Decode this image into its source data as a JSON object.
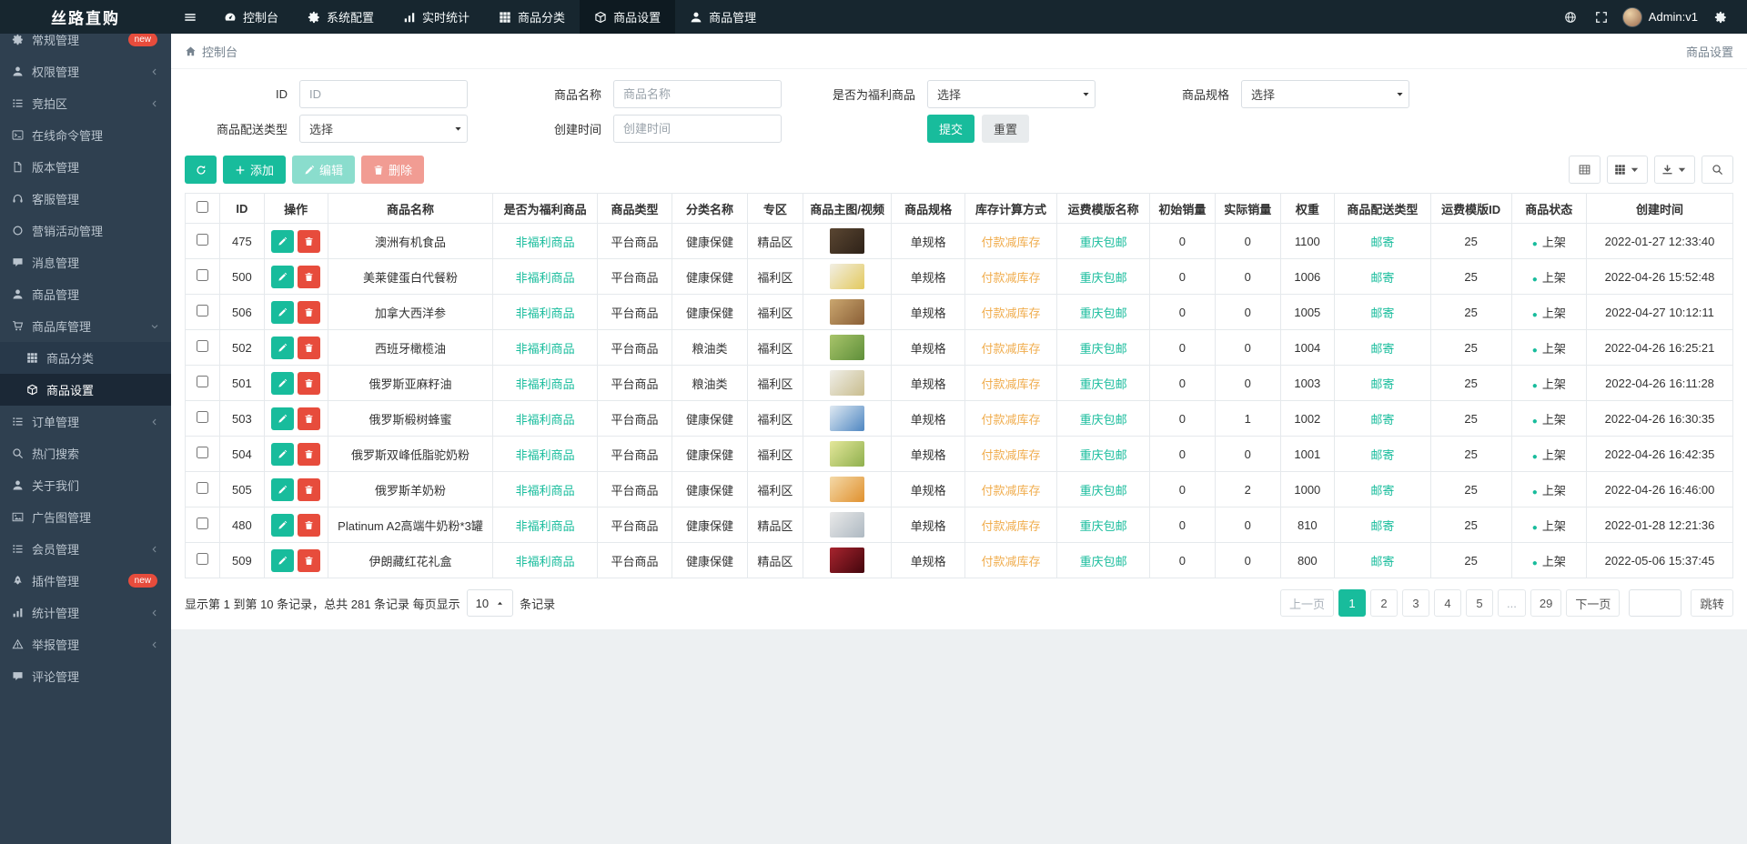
{
  "brand": {
    "logo": "丝路直购"
  },
  "colors": {
    "accent": "#18bc9c",
    "danger": "#e74c3c",
    "warning": "#f0ad4e",
    "topbar": "#17262f",
    "sidebar": "#2f4050"
  },
  "topnav": {
    "items": [
      {
        "slug": "console",
        "label": "控制台",
        "icon": "gauge",
        "active": false
      },
      {
        "slug": "system-config",
        "label": "系统配置",
        "icon": "gear",
        "active": false
      },
      {
        "slug": "realtime-stats",
        "label": "实时统计",
        "icon": "chart",
        "active": false
      },
      {
        "slug": "goods-category",
        "label": "商品分类",
        "icon": "th",
        "active": false
      },
      {
        "slug": "goods-settings",
        "label": "商品设置",
        "icon": "cube",
        "active": true
      },
      {
        "slug": "goods-management",
        "label": "商品管理",
        "icon": "user",
        "active": false
      }
    ],
    "username": "Admin:v1"
  },
  "sidebar": {
    "items": [
      {
        "slug": "general",
        "label": "常规管理",
        "icon": "gear",
        "badge": "new"
      },
      {
        "slug": "auth",
        "label": "权限管理",
        "icon": "user",
        "chevron": true
      },
      {
        "slug": "auction",
        "label": "竞拍区",
        "icon": "list",
        "chevron": true
      },
      {
        "slug": "online-command",
        "label": "在线命令管理",
        "icon": "terminal"
      },
      {
        "slug": "version",
        "label": "版本管理",
        "icon": "file"
      },
      {
        "slug": "customer-service",
        "label": "客服管理",
        "icon": "headset"
      },
      {
        "slug": "marketing",
        "label": "营销活动管理",
        "icon": "circle"
      },
      {
        "slug": "message",
        "label": "消息管理",
        "icon": "comment"
      },
      {
        "slug": "goods",
        "label": "商品管理",
        "icon": "user"
      },
      {
        "slug": "goods-store",
        "label": "商品库管理",
        "icon": "cart",
        "expanded": true,
        "children": [
          {
            "slug": "goods-category",
            "label": "商品分类",
            "icon": "th"
          },
          {
            "slug": "goods-settings",
            "label": "商品设置",
            "icon": "cube",
            "active": true
          }
        ]
      },
      {
        "slug": "order",
        "label": "订单管理",
        "icon": "list",
        "chevron": true
      },
      {
        "slug": "hot-search",
        "label": "热门搜索",
        "icon": "search"
      },
      {
        "slug": "about-us",
        "label": "关于我们",
        "icon": "user"
      },
      {
        "slug": "ad-image",
        "label": "广告图管理",
        "icon": "image"
      },
      {
        "slug": "member",
        "label": "会员管理",
        "icon": "list",
        "chevron": true
      },
      {
        "slug": "plugin",
        "label": "插件管理",
        "icon": "rocket",
        "badge": "new"
      },
      {
        "slug": "statistics",
        "label": "统计管理",
        "icon": "chart",
        "chevron": true
      },
      {
        "slug": "report",
        "label": "举报管理",
        "icon": "warning",
        "chevron": true
      },
      {
        "slug": "comments",
        "label": "评论管理",
        "icon": "comment"
      }
    ]
  },
  "breadcrumb": {
    "left": "控制台",
    "right": "商品设置"
  },
  "filters": {
    "id_label": "ID",
    "id_placeholder": "ID",
    "name_label": "商品名称",
    "name_placeholder": "商品名称",
    "welfare_label": "是否为福利商品",
    "welfare_value": "选择",
    "spec_label": "商品规格",
    "spec_value": "选择",
    "delivery_label": "商品配送类型",
    "delivery_value": "选择",
    "created_label": "创建时间",
    "created_placeholder": "创建时间",
    "submit_label": "提交",
    "reset_label": "重置"
  },
  "toolbar": {
    "add_label": "添加",
    "edit_label": "编辑",
    "delete_label": "删除"
  },
  "table": {
    "columns": [
      "ID",
      "操作",
      "商品名称",
      "是否为福利商品",
      "商品类型",
      "分类名称",
      "专区",
      "商品主图/视频",
      "商品规格",
      "库存计算方式",
      "运费模版名称",
      "初始销量",
      "实际销量",
      "权重",
      "商品配送类型",
      "运费模版ID",
      "商品状态",
      "创建时间"
    ],
    "rows": [
      {
        "id": "475",
        "name": "澳洲有机食品",
        "welfare": "非福利商品",
        "type": "平台商品",
        "category": "健康保健",
        "zone": "精品区",
        "thumb": [
          "#5a4632",
          "#2e2218"
        ],
        "spec": "单规格",
        "stock": "付款减库存",
        "freight": "重庆包邮",
        "init_sales": "0",
        "sales": "0",
        "weight": "1100",
        "delivery": "邮寄",
        "template_id": "25",
        "status": "上架",
        "created": "2022-01-27 12:33:40"
      },
      {
        "id": "500",
        "name": "美莱健蛋白代餐粉",
        "welfare": "非福利商品",
        "type": "平台商品",
        "category": "健康保健",
        "zone": "福利区",
        "thumb": [
          "#f2efe4",
          "#e3c95e"
        ],
        "spec": "单规格",
        "stock": "付款减库存",
        "freight": "重庆包邮",
        "init_sales": "0",
        "sales": "0",
        "weight": "1006",
        "delivery": "邮寄",
        "template_id": "25",
        "status": "上架",
        "created": "2022-04-26 15:52:48"
      },
      {
        "id": "506",
        "name": "加拿大西洋参",
        "welfare": "非福利商品",
        "type": "平台商品",
        "category": "健康保健",
        "zone": "福利区",
        "thumb": [
          "#caa66f",
          "#8a5f36"
        ],
        "spec": "单规格",
        "stock": "付款减库存",
        "freight": "重庆包邮",
        "init_sales": "0",
        "sales": "0",
        "weight": "1005",
        "delivery": "邮寄",
        "template_id": "25",
        "status": "上架",
        "created": "2022-04-27 10:12:11"
      },
      {
        "id": "502",
        "name": "西班牙橄榄油",
        "welfare": "非福利商品",
        "type": "平台商品",
        "category": "粮油类",
        "zone": "福利区",
        "thumb": [
          "#a8c46a",
          "#5f8f3a"
        ],
        "spec": "单规格",
        "stock": "付款减库存",
        "freight": "重庆包邮",
        "init_sales": "0",
        "sales": "0",
        "weight": "1004",
        "delivery": "邮寄",
        "template_id": "25",
        "status": "上架",
        "created": "2022-04-26 16:25:21"
      },
      {
        "id": "501",
        "name": "俄罗斯亚麻籽油",
        "welfare": "非福利商品",
        "type": "平台商品",
        "category": "粮油类",
        "zone": "福利区",
        "thumb": [
          "#efeee8",
          "#c9bd8e"
        ],
        "spec": "单规格",
        "stock": "付款减库存",
        "freight": "重庆包邮",
        "init_sales": "0",
        "sales": "0",
        "weight": "1003",
        "delivery": "邮寄",
        "template_id": "25",
        "status": "上架",
        "created": "2022-04-26 16:11:28"
      },
      {
        "id": "503",
        "name": "俄罗斯椴树蜂蜜",
        "welfare": "非福利商品",
        "type": "平台商品",
        "category": "健康保健",
        "zone": "福利区",
        "thumb": [
          "#dfe9f2",
          "#4f87c2"
        ],
        "spec": "单规格",
        "stock": "付款减库存",
        "freight": "重庆包邮",
        "init_sales": "0",
        "sales": "1",
        "weight": "1002",
        "delivery": "邮寄",
        "template_id": "25",
        "status": "上架",
        "created": "2022-04-26 16:30:35"
      },
      {
        "id": "504",
        "name": "俄罗斯双峰低脂驼奶粉",
        "welfare": "非福利商品",
        "type": "平台商品",
        "category": "健康保健",
        "zone": "福利区",
        "thumb": [
          "#e4e79a",
          "#8fb04e"
        ],
        "spec": "单规格",
        "stock": "付款减库存",
        "freight": "重庆包邮",
        "init_sales": "0",
        "sales": "0",
        "weight": "1001",
        "delivery": "邮寄",
        "template_id": "25",
        "status": "上架",
        "created": "2022-04-26 16:42:35"
      },
      {
        "id": "505",
        "name": "俄罗斯羊奶粉",
        "welfare": "非福利商品",
        "type": "平台商品",
        "category": "健康保健",
        "zone": "福利区",
        "thumb": [
          "#f4d9a8",
          "#e0912f"
        ],
        "spec": "单规格",
        "stock": "付款减库存",
        "freight": "重庆包邮",
        "init_sales": "0",
        "sales": "2",
        "weight": "1000",
        "delivery": "邮寄",
        "template_id": "25",
        "status": "上架",
        "created": "2022-04-26 16:46:00"
      },
      {
        "id": "480",
        "name": "Platinum A2高端牛奶粉*3罐",
        "welfare": "非福利商品",
        "type": "平台商品",
        "category": "健康保健",
        "zone": "精品区",
        "thumb": [
          "#e9e9e9",
          "#aeb9c2"
        ],
        "spec": "单规格",
        "stock": "付款减库存",
        "freight": "重庆包邮",
        "init_sales": "0",
        "sales": "0",
        "weight": "810",
        "delivery": "邮寄",
        "template_id": "25",
        "status": "上架",
        "created": "2022-01-28 12:21:36"
      },
      {
        "id": "509",
        "name": "伊朗藏红花礼盒",
        "welfare": "非福利商品",
        "type": "平台商品",
        "category": "健康保健",
        "zone": "精品区",
        "thumb": [
          "#a8242e",
          "#43060d"
        ],
        "spec": "单规格",
        "stock": "付款减库存",
        "freight": "重庆包邮",
        "init_sales": "0",
        "sales": "0",
        "weight": "800",
        "delivery": "邮寄",
        "template_id": "25",
        "status": "上架",
        "created": "2022-05-06 15:37:45"
      }
    ]
  },
  "pagination": {
    "summary_prefix": "显示第 1 到第 10 条记录，总共 281 条记录 每页显示",
    "per_page": "10",
    "summary_suffix": "条记录",
    "pages": [
      {
        "slug": "prev",
        "label": "上一页",
        "state": "disabled"
      },
      {
        "slug": "1",
        "label": "1",
        "state": "active"
      },
      {
        "slug": "2",
        "label": "2"
      },
      {
        "slug": "3",
        "label": "3"
      },
      {
        "slug": "4",
        "label": "4"
      },
      {
        "slug": "5",
        "label": "5"
      },
      {
        "slug": "ellipsis",
        "label": "...",
        "state": "disabled"
      },
      {
        "slug": "29",
        "label": "29"
      },
      {
        "slug": "next",
        "label": "下一页"
      }
    ],
    "jump_label": "跳转"
  }
}
